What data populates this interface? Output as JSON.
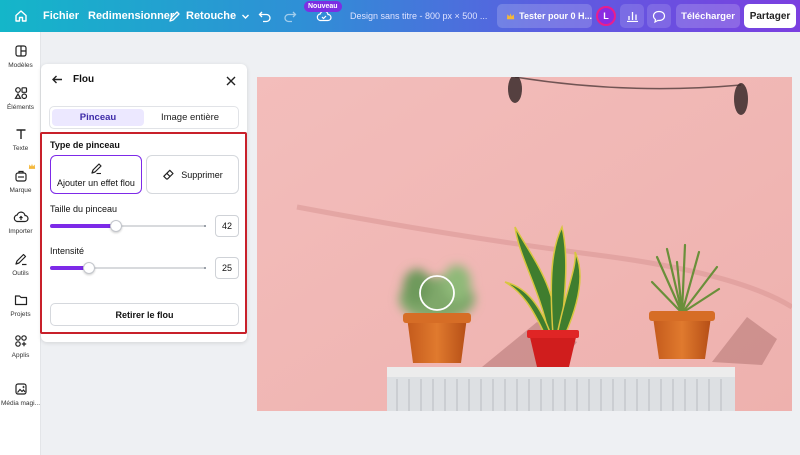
{
  "topbar": {
    "menu_file": "Fichier",
    "menu_resize": "Redimensionner",
    "menu_retouch": "Retouche",
    "badge_new": "Nouveau",
    "doc_title": "Design sans titre - 800 px × 500 ...",
    "try_pro": "Tester pour 0 H...",
    "avatar_initial": "L",
    "download_label": "Télécharger",
    "share_label": "Partager"
  },
  "sidebar": {
    "items": [
      {
        "label": "Modèles",
        "icon": "templates-icon"
      },
      {
        "label": "Éléments",
        "icon": "elements-icon"
      },
      {
        "label": "Texte",
        "icon": "text-icon"
      },
      {
        "label": "Marque",
        "icon": "brand-icon"
      },
      {
        "label": "Importer",
        "icon": "upload-icon"
      },
      {
        "label": "Outils",
        "icon": "tools-icon"
      },
      {
        "label": "Projets",
        "icon": "folder-icon"
      },
      {
        "label": "Applis",
        "icon": "apps-icon"
      },
      {
        "label": "Média magi...",
        "icon": "magic-media-icon"
      }
    ]
  },
  "panel": {
    "title": "Flou",
    "tabs": [
      {
        "label": "Pinceau",
        "active": true
      },
      {
        "label": "Image entière",
        "active": false
      }
    ],
    "brush_type_label": "Type de pinceau",
    "brush_add_label": "Ajouter un effet flou",
    "brush_erase_label": "Supprimer",
    "brush_size_label": "Taille du pinceau",
    "brush_size_value": "42",
    "intensity_label": "Intensité",
    "intensity_value": "25",
    "remove_blur_label": "Retirer le flou"
  },
  "colors": {
    "accent": "#7d2ae8",
    "highlight": "#c8202a",
    "canvas_wall": "#f0b7b5"
  }
}
